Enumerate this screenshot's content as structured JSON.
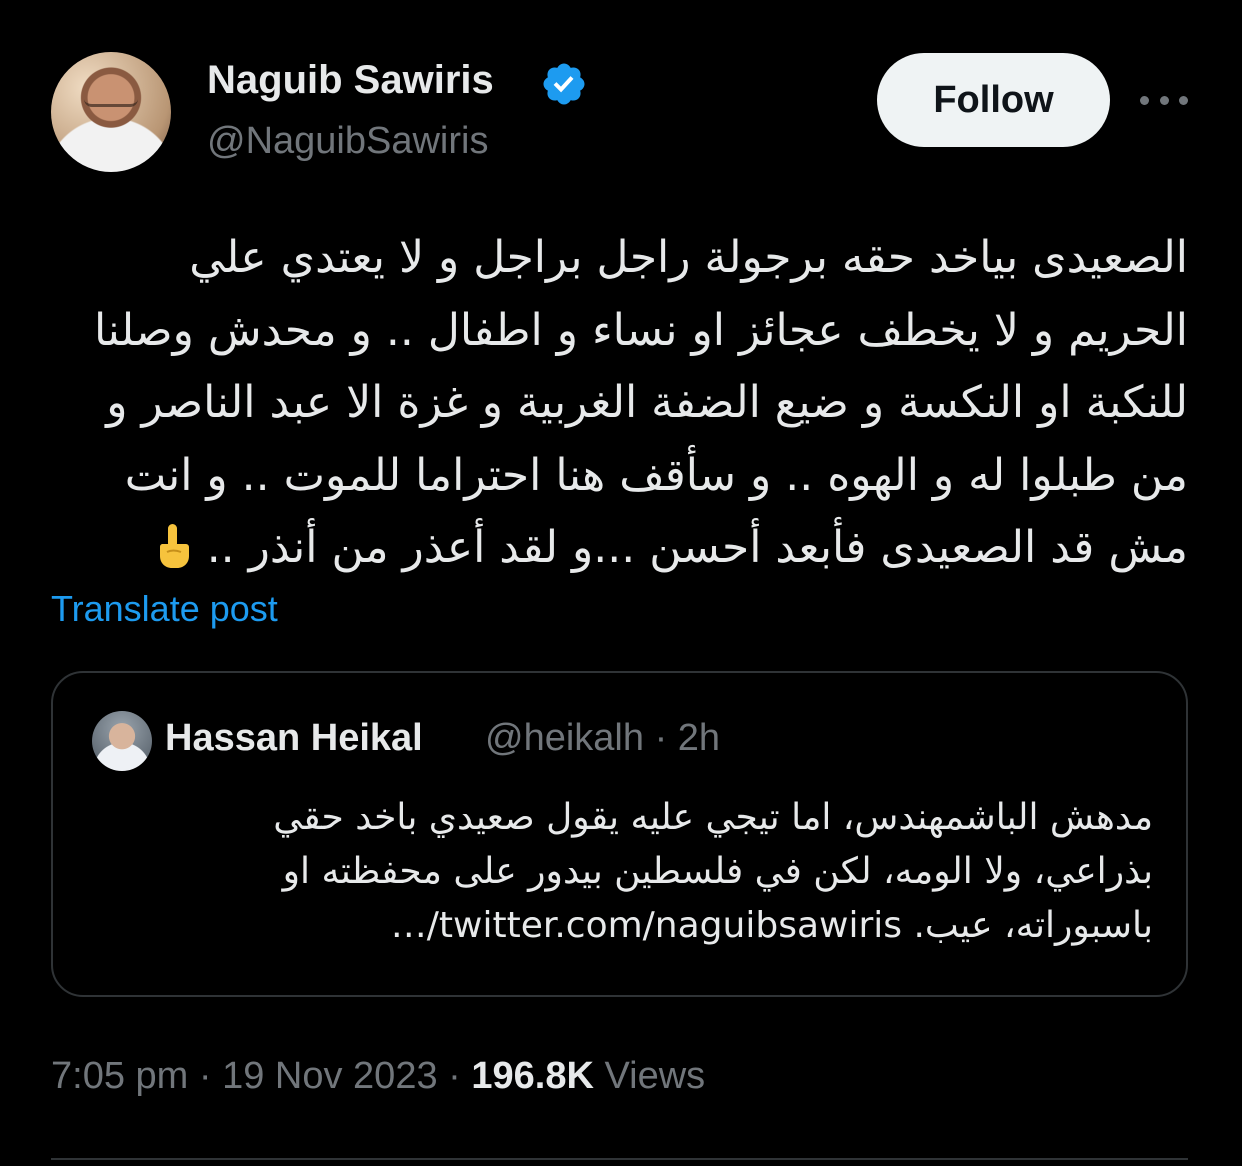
{
  "author": {
    "display_name": "Naguib Sawiris",
    "handle": "@NaguibSawiris",
    "verified_icon": "verified-badge-icon",
    "accent_color": "#1d9bf0"
  },
  "actions": {
    "follow_label": "Follow",
    "more_icon": "more-dots-icon"
  },
  "post": {
    "lines": [
      "الصعيدى بياخد حقه برجولة راجل براجل و لا يعتدي علي",
      "الحريم و لا يخطف عجائز او نساء و اطفال .. و محدش وصلنا",
      "للنكبة او النكسة و ضيع الضفة الغربية و غزة الا عبد الناصر و",
      "من طبلوا له و الهوه .. و سأقف هنا احتراما للموت .. و انت",
      "مش قد الصعيدى فأبعد أحسن ...و لقد أعذر من أنذر .."
    ],
    "emoji": "☝️",
    "translate_label": "Translate post"
  },
  "quoted": {
    "name": "Hassan Heikal",
    "handle": "@heikalh",
    "separator": "·",
    "time": "2h",
    "lines": [
      "مدهش الباشمهندس، اما تيجي عليه يقول صعيدي باخد حقي",
      "بذراعي، ولا الومه، لكن في فلسطين بيدور على محفظته او",
      "باسبوراته، عيب. twitter.com/naguibsawiris/…"
    ]
  },
  "meta": {
    "time": "7:05 pm",
    "separator": "·",
    "date": "19 Nov 2023",
    "views_count": "196.8K",
    "views_label": "Views"
  }
}
